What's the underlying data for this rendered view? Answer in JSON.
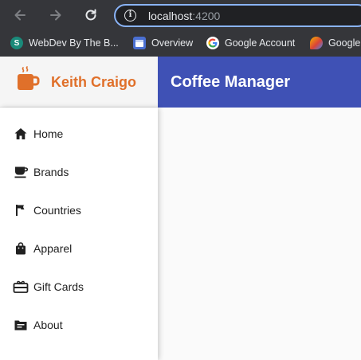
{
  "browser": {
    "url_host": "localhost",
    "url_port": ":4200",
    "bookmarks": [
      {
        "label": "WebDev By The B...",
        "icon": "S"
      },
      {
        "label": "Overview",
        "icon": "calendar-icon"
      },
      {
        "label": "Google Account",
        "icon": "G"
      },
      {
        "label": "Google",
        "icon": "google-favicon"
      }
    ]
  },
  "app": {
    "brand": "Keith Craigo",
    "title": "Coffee Manager",
    "brand_color": "#e0702a",
    "toolbar_color": "#3f51b5"
  },
  "nav": [
    {
      "label": "Home",
      "icon": "home-icon"
    },
    {
      "label": "Brands",
      "icon": "coffee-cup-icon"
    },
    {
      "label": "Countries",
      "icon": "flag-icon"
    },
    {
      "label": "Apparel",
      "icon": "shopping-bag-icon"
    },
    {
      "label": "Gift Cards",
      "icon": "gift-card-icon"
    },
    {
      "label": "About",
      "icon": "folder-icon"
    }
  ]
}
